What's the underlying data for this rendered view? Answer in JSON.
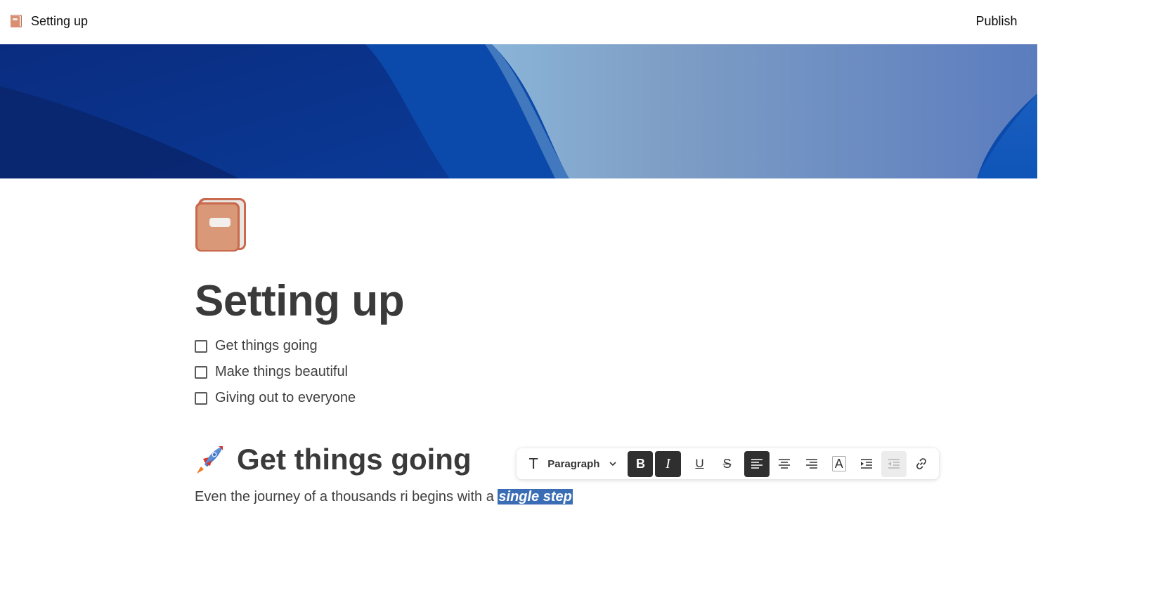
{
  "topbar": {
    "doc_title": "Setting up",
    "publish_label": "Publish"
  },
  "page": {
    "title": "Setting up",
    "todos": [
      {
        "label": "Get things going",
        "checked": false
      },
      {
        "label": "Make things beautiful",
        "checked": false
      },
      {
        "label": "Giving out to everyone",
        "checked": false
      }
    ],
    "heading_emoji": "rocket-icon",
    "heading": "Get things going",
    "paragraph_plain": "Even the journey of a thousands ri begins with a ",
    "paragraph_selected": "single step"
  },
  "toolbar": {
    "block_type": "Paragraph",
    "buttons": [
      {
        "name": "bold",
        "active": true
      },
      {
        "name": "italic",
        "active": true
      },
      {
        "name": "underline",
        "active": false
      },
      {
        "name": "strikethrough",
        "active": false
      },
      {
        "name": "align-left",
        "active": true
      },
      {
        "name": "align-center",
        "active": false
      },
      {
        "name": "align-right",
        "active": false
      },
      {
        "name": "text-color",
        "active": false
      },
      {
        "name": "indent",
        "active": false
      },
      {
        "name": "outdent",
        "active": false,
        "disabled": true
      },
      {
        "name": "link",
        "active": false
      }
    ]
  },
  "colors": {
    "selection": "#3a6db4",
    "active_button": "#2f2f2f",
    "text": "#3a3a3a",
    "book_icon": "#c9694d"
  }
}
